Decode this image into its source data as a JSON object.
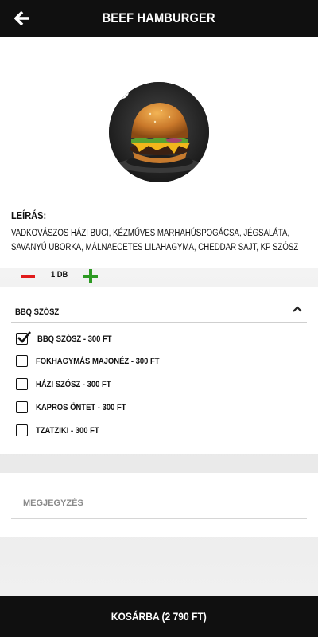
{
  "header": {
    "title": "BEEF HAMBURGER",
    "back_icon": "arrow-left-icon"
  },
  "product": {
    "image_icon": "burger-photo",
    "description_label": "LEÍRÁS:",
    "description": "Vadkovászos házi buci, kézműves marhahúspogácsa, jégsaláta, savanyú uborka, málnaecetes lilahagyma, cheddar sajt, KP szósz",
    "quantity": "1 DB",
    "minus_color": "#e11b1b",
    "plus_color": "#2d9a23"
  },
  "sauce": {
    "title": "BBQ SZÓSZ",
    "options": [
      {
        "label": "BBQ SZÓSZ - 300 FT",
        "checked": true
      },
      {
        "label": "FOKHAGYMÁS MAJONÉZ - 300 FT",
        "checked": false
      },
      {
        "label": "HÁZI SZÓSZ - 300 FT",
        "checked": false
      },
      {
        "label": "KAPROS ÖNTET - 300 FT",
        "checked": false
      },
      {
        "label": "TZATZIKI - 300 FT",
        "checked": false
      }
    ]
  },
  "note": {
    "placeholder": "MEGJEGYZÉS"
  },
  "cart": {
    "label": "KOSÁRBA (2 790 FT)"
  }
}
